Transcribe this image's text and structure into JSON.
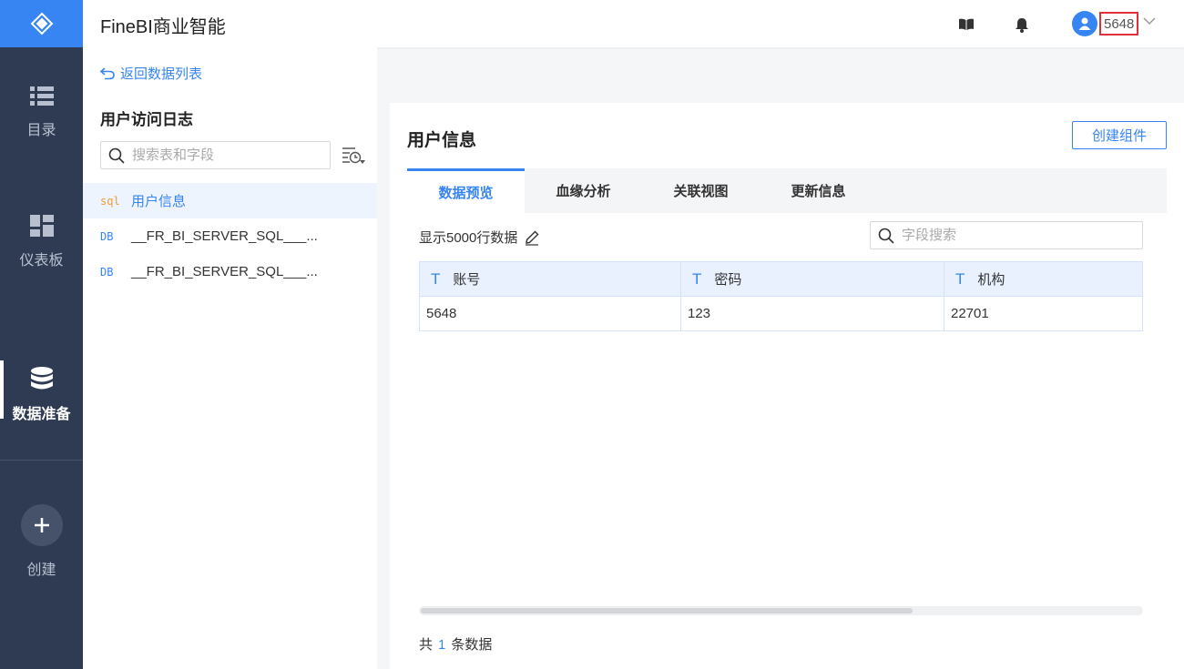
{
  "app": {
    "title": "FineBI商业智能"
  },
  "colors": {
    "accent": "#3685f2",
    "nav_bg": "#2f3b52",
    "highlight_border": "#e0303a",
    "sql_tag": "#f29a38"
  },
  "nav": {
    "items": [
      {
        "label": "目录",
        "icon": "list-icon"
      },
      {
        "label": "仪表板",
        "icon": "dashboard-icon"
      },
      {
        "label": "数据准备",
        "icon": "database-icon",
        "active": true
      }
    ],
    "create_label": "创建"
  },
  "header": {
    "username": "5648"
  },
  "left_panel": {
    "back_label": "返回数据列表",
    "title": "用户访问日志",
    "search_placeholder": "搜索表和字段",
    "items": [
      {
        "tag": "sql",
        "label": "用户信息",
        "selected": true
      },
      {
        "tag": "DB",
        "label": "__FR_BI_SERVER_SQL___..."
      },
      {
        "tag": "DB",
        "label": "__FR_BI_SERVER_SQL___..."
      }
    ]
  },
  "main": {
    "title": "用户信息",
    "create_button": "创建组件",
    "tabs": [
      {
        "label": "数据预览",
        "active": true
      },
      {
        "label": "血缘分析"
      },
      {
        "label": "关联视图"
      },
      {
        "label": "更新信息"
      }
    ],
    "rows_info": "显示5000行数据",
    "field_search_placeholder": "字段搜索",
    "table": {
      "type_marker": "T",
      "columns": [
        "账号",
        "密码",
        "机构"
      ],
      "rows": [
        [
          "5648",
          "123",
          "22701"
        ]
      ]
    },
    "footer": {
      "prefix": "共",
      "count": "1",
      "suffix": "条数据"
    }
  }
}
